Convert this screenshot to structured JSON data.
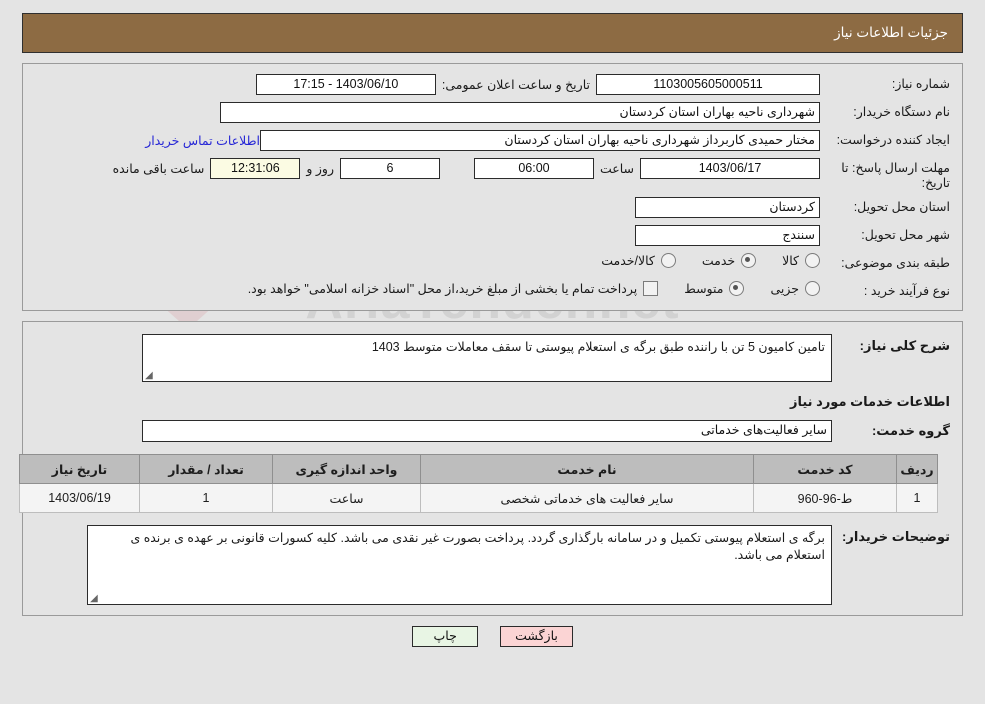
{
  "header": {
    "title": "جزئیات اطلاعات نیاز"
  },
  "general": {
    "need_number_label": "شماره نیاز:",
    "need_number_value": "1103005605000511",
    "announce_label": "تاریخ و ساعت اعلان عمومی:",
    "announce_value": "1403/06/10 - 17:15",
    "org_label": "نام دستگاه خریدار:",
    "org_value": "شهرداری ناحیه بهاران استان کردستان",
    "creator_label": "ایجاد کننده درخواست:",
    "creator_value": "مختار حمیدی کاربرداز شهرداری ناحیه بهاران استان کردستان",
    "contact_link": "اطلاعات تماس خریدار",
    "deadline_label": "مهلت ارسال پاسخ: تا تاریخ:",
    "deadline_date": "1403/06/17",
    "hour_label": "ساعت",
    "deadline_hour": "06:00",
    "remaining_days": "6",
    "days_label": "روز و",
    "remaining_time": "12:31:06",
    "remaining_suffix": "ساعت باقی مانده",
    "province_label": "استان محل تحویل:",
    "province_value": "کردستان",
    "city_label": "شهر محل تحویل:",
    "city_value": "سنندج",
    "category_label": "طبقه بندی موضوعی:",
    "category_options": [
      {
        "label": "کالا",
        "selected": false
      },
      {
        "label": "خدمت",
        "selected": true
      },
      {
        "label": "کالا/خدمت",
        "selected": false
      }
    ],
    "process_label": "نوع فرآیند خرید :",
    "process_options": [
      {
        "label": "جزیی",
        "selected": false
      },
      {
        "label": "متوسط",
        "selected": true
      }
    ],
    "treasury_checkbox_checked": false,
    "treasury_note": "پرداخت تمام یا بخشی از مبلغ خرید،از محل \"اسناد خزانه اسلامی\" خواهد بود."
  },
  "details": {
    "summary_label": "شرح کلی نیاز:",
    "summary_value": "تامین کامیون 5 تن با راننده طبق برگه ی استعلام پیوستی تا سقف معاملات متوسط 1403",
    "services_section_title": "اطلاعات خدمات مورد نیاز",
    "service_group_label": "گروه خدمت:",
    "service_group_value": "سایر فعالیت‌های خدماتی",
    "table": {
      "columns": [
        "ردیف",
        "کد خدمت",
        "نام خدمت",
        "واحد اندازه گیری",
        "تعداد / مقدار",
        "تاریخ نیاز"
      ],
      "rows": [
        {
          "radif": "1",
          "code": "ط-96-960",
          "name": "سایر فعالیت های خدماتی شخصی",
          "unit": "ساعت",
          "qty": "1",
          "date": "1403/06/19"
        }
      ]
    },
    "notes_label": "توضیحات خریدار:",
    "notes_value": "برگه ی استعلام پیوستی تکمیل و در سامانه بارگذاری گردد. پرداخت بصورت غیر نقدی می باشد. کلیه کسورات قانونی بر عهده ی برنده ی استعلام می باشد."
  },
  "footer": {
    "print_label": "چاپ",
    "back_label": "بازگشت"
  },
  "watermark": {
    "text": "AriaTender.net",
    "mark": "V",
    "secondary": "T"
  },
  "colors": {
    "header_bg": "#8d6b43",
    "page_bg": "#e4e4e4",
    "link": "#2626d6",
    "table_header": "#bdbdbd",
    "print_btn": "#e8f5e4",
    "back_btn": "#fbd4d4",
    "highlight_field": "#fbfbe3"
  }
}
